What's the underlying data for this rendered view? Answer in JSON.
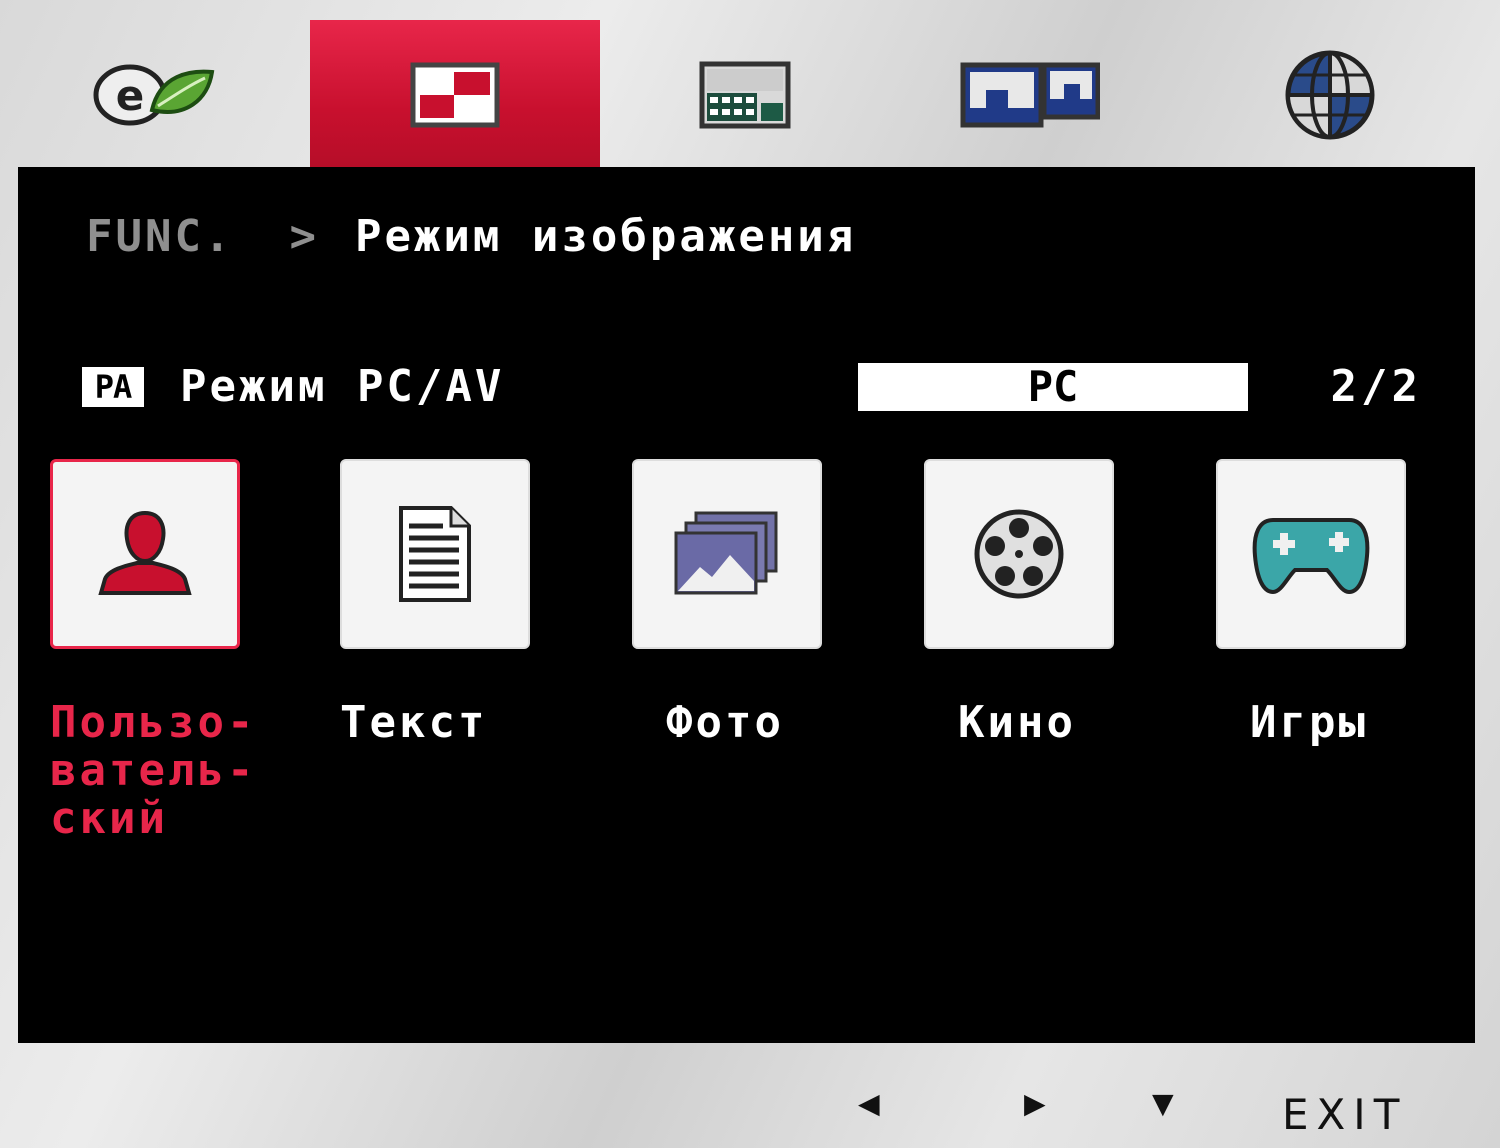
{
  "top_tabs": [
    {
      "icon": "eco-leaf-icon",
      "active": false
    },
    {
      "icon": "picture-mode-icon",
      "active": true
    },
    {
      "icon": "settings-grid-icon",
      "active": false
    },
    {
      "icon": "dual-screen-icon",
      "active": false
    },
    {
      "icon": "globe-icon",
      "active": false
    }
  ],
  "breadcrumb": {
    "root": "FUNC.",
    "separator": ">",
    "current": "Режим изображения"
  },
  "mode_row": {
    "badge": "PA",
    "label": "Режим PC/AV",
    "value": "PC",
    "page": "2/2"
  },
  "tiles": [
    {
      "label": "Пользо-\nватель-\nский",
      "icon": "user-icon",
      "selected": true
    },
    {
      "label": "Текст",
      "icon": "document-icon",
      "selected": false
    },
    {
      "label": "Фото",
      "icon": "photo-icon",
      "selected": false
    },
    {
      "label": "Кино",
      "icon": "film-reel-icon",
      "selected": false
    },
    {
      "label": "Игры",
      "icon": "gamepad-icon",
      "selected": false
    }
  ],
  "bottom_nav": {
    "left": "◀",
    "right": "▶",
    "down": "▼",
    "exit": "EXIT"
  },
  "colors": {
    "accent": "#e8264a",
    "panel": "#000000",
    "text": "#ffffff",
    "muted": "#8f8f8f"
  }
}
